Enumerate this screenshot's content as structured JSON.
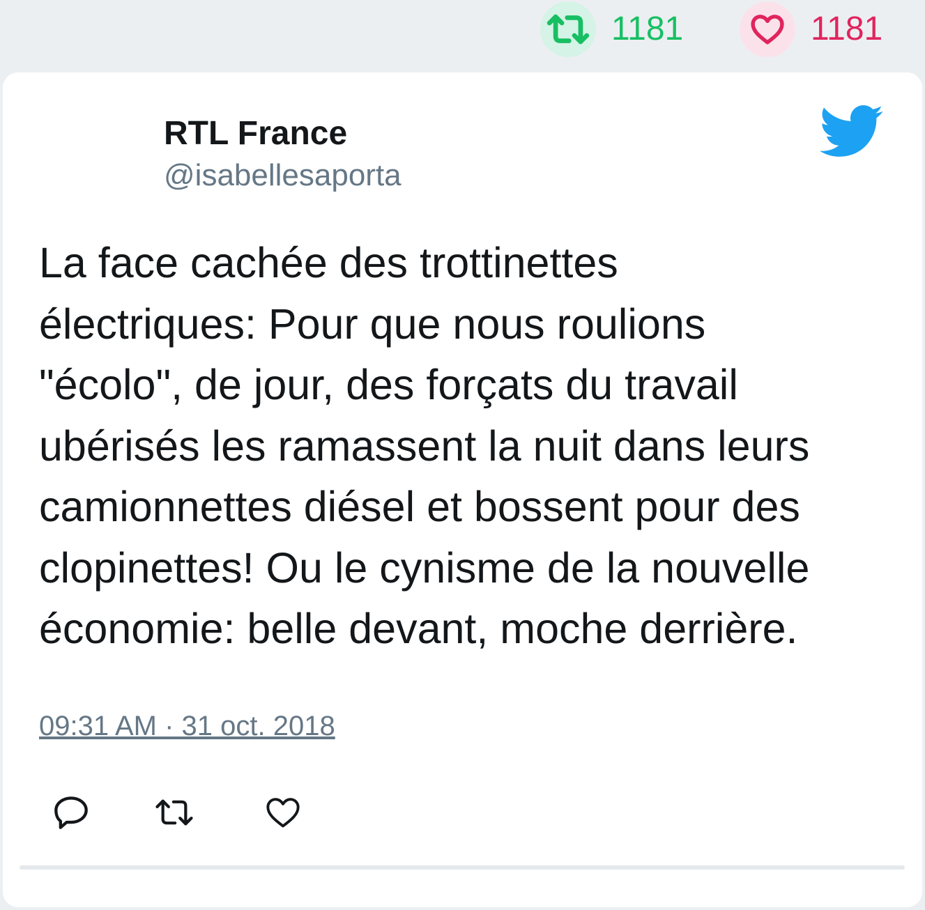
{
  "stats": {
    "retweet_count": "1181",
    "like_count": "1181",
    "retweet_color": "#17bf63",
    "like_color": "#e0245e"
  },
  "author": {
    "name": "RTL France",
    "handle": "@isabellesaporta"
  },
  "tweet": {
    "lines": [
      "La face cachée des trottinettes",
      "électriques: Pour que nous roulions",
      "\"écolo\", de jour, des forçats du travail",
      "ubérisés les ramassent la nuit dans leurs",
      "camionnettes diésel et bossent pour des",
      "clopinettes! Ou le cynisme de la nouvelle",
      "économie: belle devant, moche derrière."
    ],
    "timestamp": "09:31 AM · 31 oct. 2018"
  },
  "icons": {
    "brand": "twitter-bird-icon",
    "brand_color": "#1da1f2",
    "actions": [
      "reply-icon",
      "retweet-icon",
      "like-icon"
    ]
  }
}
